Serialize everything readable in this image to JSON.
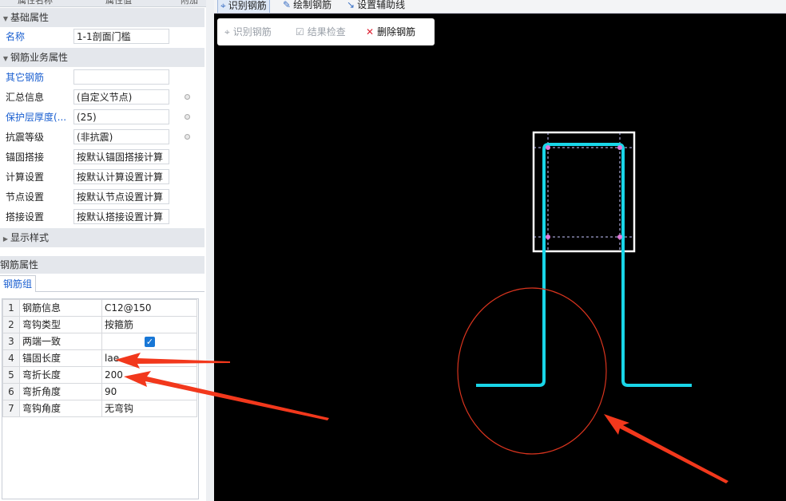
{
  "left_panel": {
    "header": {
      "col1": "属性名称",
      "col2": "属性值",
      "col3": "附加"
    },
    "groups": {
      "basic": "基础属性",
      "rebar_business": "钢筋业务属性",
      "display": "显示样式"
    },
    "props": [
      {
        "name": "名称",
        "value": "1-1剖面门槛"
      },
      {
        "name": "其它钢筋",
        "value": ""
      },
      {
        "name": "汇总信息",
        "value": "(自定义节点)"
      },
      {
        "name": "保护层厚度(...",
        "value": "(25)"
      },
      {
        "name": "抗震等级",
        "value": "(非抗震)"
      },
      {
        "name": "锚固搭接",
        "value": "按默认锚固搭接计算"
      },
      {
        "name": "计算设置",
        "value": "按默认计算设置计算"
      },
      {
        "name": "节点设置",
        "value": "按默认节点设置计算"
      },
      {
        "name": "搭接设置",
        "value": "按默认搭接设置计算"
      }
    ],
    "section_title": "钢筋属性",
    "tab": "钢筋组",
    "grid": [
      {
        "idx": "1",
        "k": "钢筋信息",
        "v": "C12@150"
      },
      {
        "idx": "2",
        "k": "弯钩类型",
        "v": "按箍筋"
      },
      {
        "idx": "3",
        "k": "两端一致",
        "v": ""
      },
      {
        "idx": "4",
        "k": "锚固长度",
        "v": "lae"
      },
      {
        "idx": "5",
        "k": "弯折长度",
        "v": "200"
      },
      {
        "idx": "6",
        "k": "弯折角度",
        "v": "90"
      },
      {
        "idx": "7",
        "k": "弯钩角度",
        "v": "无弯钩"
      }
    ]
  },
  "toolbar": {
    "identify": "识别钢筋",
    "draw": "绘制钢筋",
    "aux": "设置辅助线"
  },
  "cad_toolbar": {
    "identify": "识别钢筋",
    "check": "结果检查",
    "delete": "删除钢筋"
  },
  "colors": {
    "rebar": "#19d6e8",
    "circle": "#d9341e",
    "arrow": "#f2381c",
    "link": "#1a5fd0"
  }
}
